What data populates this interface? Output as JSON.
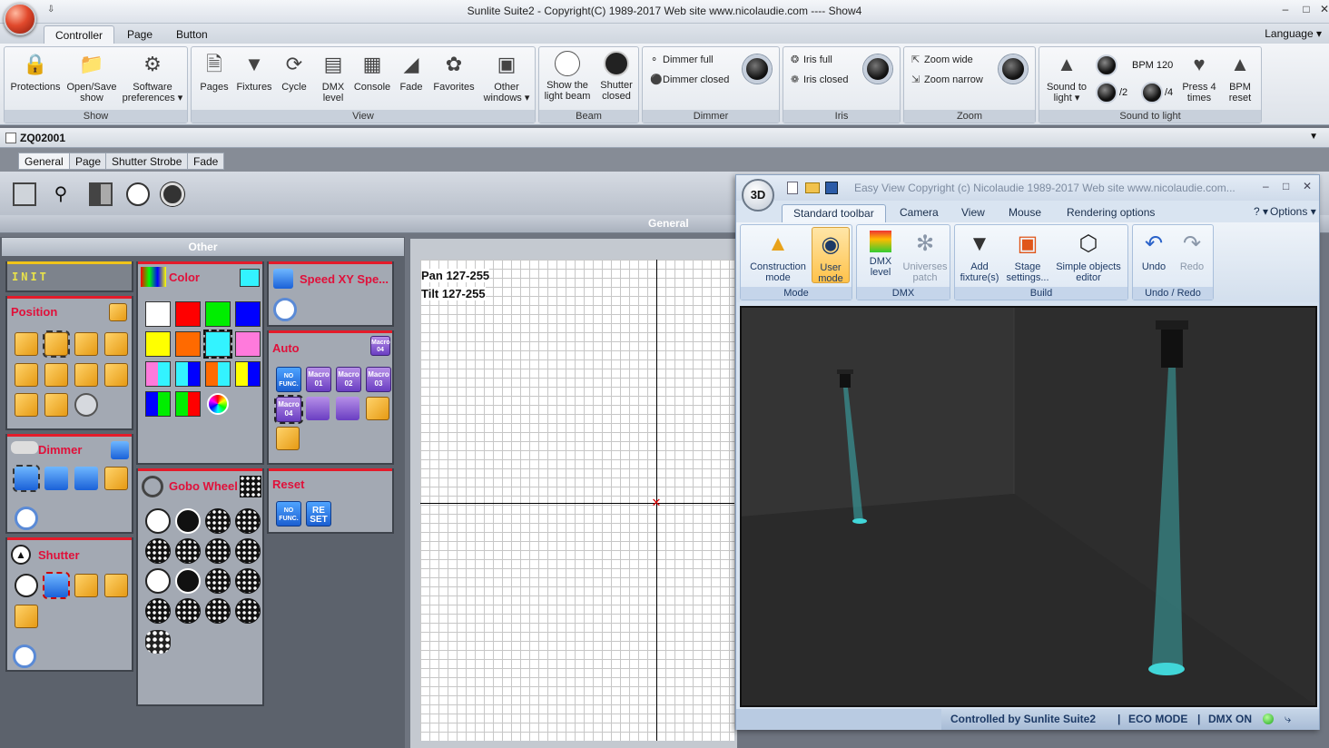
{
  "window": {
    "title": "Sunlite Suite2 - Copyright(C) 1989-2017    Web site www.nicolaudie.com ---- Show4",
    "quick_access": "⇩"
  },
  "ribbon_tabs": [
    "Controller",
    "Page",
    "Button"
  ],
  "language_label": "Language ▾",
  "ribbon_groups": {
    "show": {
      "caption": "Show",
      "buttons": [
        "Protections",
        "Open/Save show",
        "Software preferences ▾"
      ]
    },
    "view": {
      "caption": "View",
      "buttons": [
        "Pages",
        "Fixtures",
        "Cycle",
        "DMX level",
        "Console",
        "Fade",
        "Favorites",
        "Other windows ▾"
      ]
    },
    "beam": {
      "caption": "Beam",
      "buttons": [
        "Show the light beam",
        "Shutter closed"
      ]
    },
    "dimmer": {
      "caption": "Dimmer",
      "items": [
        "Dimmer full",
        "Dimmer closed"
      ]
    },
    "iris": {
      "caption": "Iris",
      "items": [
        "Iris full",
        "Iris closed"
      ]
    },
    "zoom": {
      "caption": "Zoom",
      "items": [
        "Zoom wide",
        "Zoom narrow"
      ]
    },
    "sound": {
      "caption": "Sound to light",
      "sound_btn": "Sound to light ▾",
      "bpm": "BPM 120",
      "div2": "/2",
      "div4": "/4",
      "press4": "Press 4 times",
      "bpm_reset": "BPM reset"
    }
  },
  "document": {
    "name": "ZQ02001"
  },
  "sub_tabs": [
    "General",
    "Page",
    "Shutter Strobe",
    "Fade"
  ],
  "general_label": "General",
  "other_panel": {
    "header": "Other",
    "init": "INIT",
    "position": "Position",
    "dimmer": "Dimmer",
    "shutter": "Shutter",
    "color": "Color",
    "gobo": "Gobo Wheel",
    "speed": "Speed XY Spe...",
    "auto": "Auto",
    "reset": "Reset",
    "macros": [
      "Macro 01",
      "Macro 02",
      "Macro 03",
      "Macro 04"
    ],
    "nofunc": "NO FUNC.",
    "reset_btn": "RE SET",
    "colors": [
      "#ffffff",
      "#ff0000",
      "#00ee00",
      "#0000ff",
      "#ffff00",
      "#ff6a00",
      "#33f3ff",
      "#ff7adc"
    ]
  },
  "pantilt": {
    "pan": "Pan 127-255",
    "tilt": "Tilt 127-255"
  },
  "easyview": {
    "title": "Easy View   Copyright (c) Nicolaudie 1989-2017    Web site www.nicolaudie.com...",
    "badge": "3D",
    "tabs": [
      "Standard toolbar",
      "Camera",
      "View",
      "Mouse",
      "Rendering options"
    ],
    "options": "Options ▾",
    "groups": {
      "mode": {
        "caption": "Mode",
        "buttons": [
          "Construction mode",
          "User mode"
        ]
      },
      "dmx": {
        "caption": "DMX",
        "buttons": [
          "DMX level",
          "Universes patch"
        ]
      },
      "build": {
        "caption": "Build",
        "buttons": [
          "Add fixture(s)",
          "Stage settings...",
          "Simple objects editor"
        ]
      },
      "undo": {
        "caption": "Undo / Redo",
        "buttons": [
          "Undo",
          "Redo"
        ]
      }
    },
    "status": {
      "controlled": "Controlled by Sunlite Suite2",
      "eco": "ECO MODE",
      "dmx": "DMX ON",
      "sep": "|"
    }
  }
}
